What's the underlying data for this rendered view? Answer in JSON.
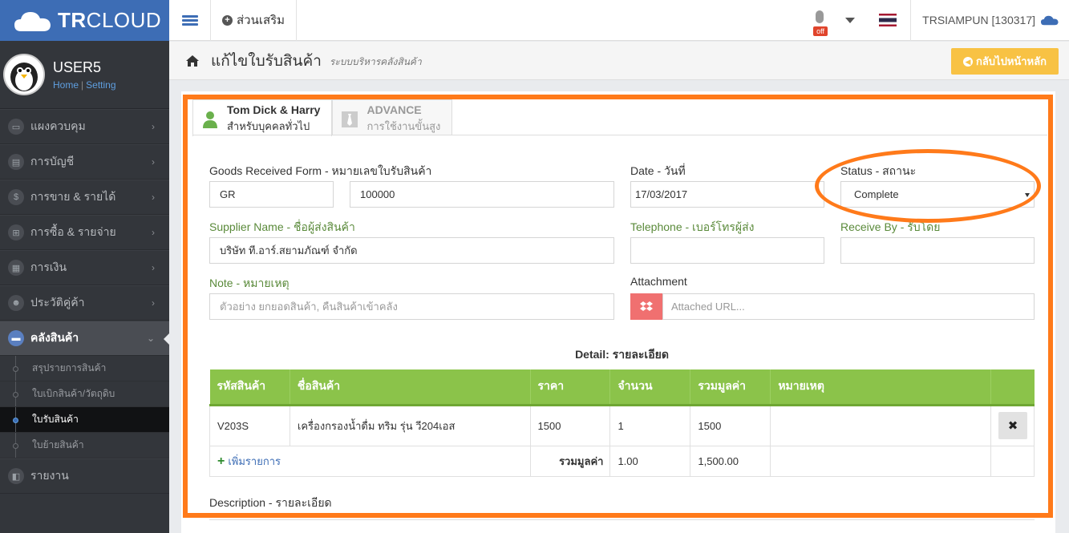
{
  "brand": {
    "name_bold": "TR",
    "name_rest": "CLOUD"
  },
  "user": {
    "name": "USER5",
    "home_link": "Home",
    "setting_link": "Setting"
  },
  "sidebar": {
    "items": [
      {
        "label": "แผงควบคุม",
        "icon": "monitor-icon"
      },
      {
        "label": "การบัญชี",
        "icon": "book-icon"
      },
      {
        "label": "การขาย & รายได้",
        "icon": "dollar-icon"
      },
      {
        "label": "การซื้อ & รายจ่าย",
        "icon": "cart-icon"
      },
      {
        "label": "การเงิน",
        "icon": "calendar-icon"
      },
      {
        "label": "ประวัติคู่ค้า",
        "icon": "users-icon"
      },
      {
        "label": "คลังสินค้า",
        "icon": "truck-icon"
      },
      {
        "label": "รายงาน",
        "icon": "report-icon"
      }
    ],
    "subitems": [
      {
        "label": "สรุปรายการสินค้า"
      },
      {
        "label": "ใบเบิกสินค้า/วัตถุดิบ"
      },
      {
        "label": "ใบรับสินค้า"
      },
      {
        "label": "ใบย้ายสินค้า"
      }
    ]
  },
  "topbar": {
    "addon_label": "ส่วนเสริม",
    "mic_badge": "off",
    "account": "TRSIAMPUN [130317]"
  },
  "page": {
    "title": "แก้ไขใบรับสินค้า",
    "subtitle": "ระบบบริหารคลังสินค้า",
    "back_button": "กลับไปหน้าหลัก"
  },
  "tabs": [
    {
      "title": "Tom Dick & Harry",
      "sub": "สำหรับบุคคลทั่วไป"
    },
    {
      "title": "ADVANCE",
      "sub": "การใช้งานขั้นสูง"
    }
  ],
  "form": {
    "gr_label": "Goods Received Form - หมายเลขใบรับสินค้า",
    "gr_prefix": "GR",
    "gr_number": "100000",
    "date_label": "Date - วันที่",
    "date_value": "17/03/2017",
    "status_label": "Status - สถานะ",
    "status_value": "Complete",
    "supplier_label": "Supplier Name - ชื่อผู้ส่งสินค้า",
    "supplier_value": "บริษัท ที.อาร์.สยามภัณฑ์ จำกัด",
    "telephone_label": "Telephone - เบอร์โทรผู้ส่ง",
    "receive_label": "Receive By - รับโดย",
    "note_label": "Note - หมายเหตุ",
    "note_placeholder": "ตัวอย่าง ยกยอดสินค้า, คืนสินค้าเข้าคลัง",
    "attachment_label": "Attachment",
    "attachment_placeholder": "Attached URL..."
  },
  "detail": {
    "title": "Detail: รายละเอียด",
    "headers": [
      "รหัสสินค้า",
      "ชื่อสินค้า",
      "ราคา",
      "จำนวน",
      "รวมมูลค่า",
      "หมายเหตุ"
    ],
    "rows": [
      {
        "code": "V203S",
        "name": "เครื่องกรองน้ำดื่ม ทริม รุ่น วี204เอส",
        "price": "1500",
        "qty": "1",
        "total": "1500",
        "note": ""
      }
    ],
    "add_item": "เพิ่มรายการ",
    "sum_label": "รวมมูลค่า",
    "sum_qty": "1.00",
    "sum_total": "1,500.00"
  },
  "description_label": "Description - รายละเอียด",
  "colors": {
    "brand": "#3d6db5",
    "sidebar": "#33363b",
    "table_header": "#8bc34a",
    "highlight": "#ff7a1a",
    "back_button": "#f8c244"
  }
}
